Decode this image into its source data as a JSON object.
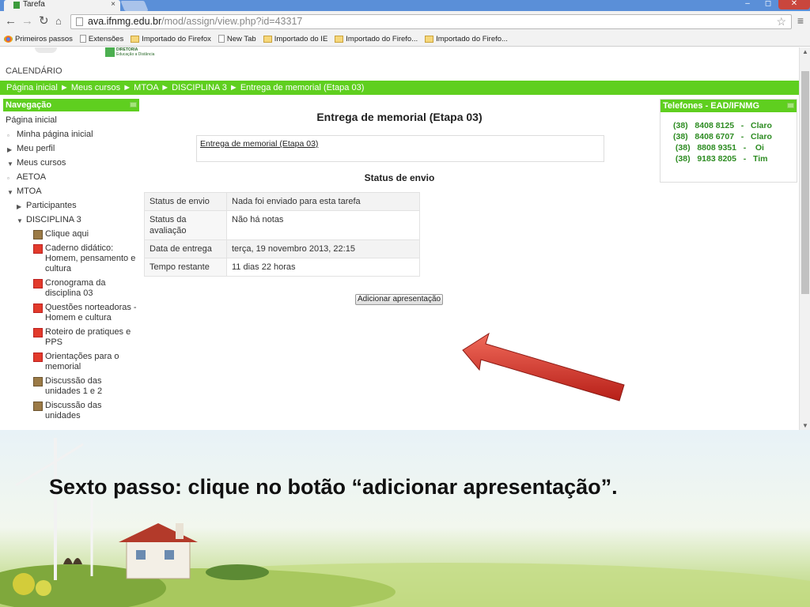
{
  "browser": {
    "tab_title": "Tarefa",
    "tab_close": "×",
    "url_host": "ava.ifnmg.edu.br",
    "url_path": "/mod/assign/view.php?id=43317",
    "bookmarks": [
      {
        "label": "Primeiros passos",
        "icon": "chrome"
      },
      {
        "label": "Extensões",
        "icon": "page"
      },
      {
        "label": "Importado do Firefox",
        "icon": "folder"
      },
      {
        "label": "New Tab",
        "icon": "page"
      },
      {
        "label": "Importado do IE",
        "icon": "folder"
      },
      {
        "label": "Importado do Firefo...",
        "icon": "folder"
      },
      {
        "label": "Importado do Firefo...",
        "icon": "folder"
      }
    ]
  },
  "site": {
    "logo_line1": "DIRETORIA",
    "logo_line2": "Educação a Distância",
    "calendar": "CALENDÁRIO",
    "breadcrumb": "Página inicial ► Meus cursos ► MTOA ► DISCIPLINA 3 ► Entrega de memorial (Etapa 03)"
  },
  "nav": {
    "title": "Navegação",
    "items": [
      {
        "label": "Página inicial",
        "indent": 0,
        "marker": "none"
      },
      {
        "label": "Minha página inicial",
        "indent": 1,
        "marker": "bullet"
      },
      {
        "label": "Meu perfil",
        "indent": 1,
        "marker": "collapsed"
      },
      {
        "label": "Meus cursos",
        "indent": 1,
        "marker": "expanded"
      },
      {
        "label": "AETOA",
        "indent": 2,
        "marker": "bullet"
      },
      {
        "label": "MTOA",
        "indent": 2,
        "marker": "expanded"
      },
      {
        "label": "Participantes",
        "indent": 3,
        "marker": "collapsed"
      },
      {
        "label": "DISCIPLINA 3",
        "indent": 3,
        "marker": "expanded"
      },
      {
        "label": "Clique aqui",
        "indent": 4,
        "marker": "forum"
      },
      {
        "label": "Caderno didático: Homem, pensamento e cultura",
        "indent": 4,
        "marker": "pdf"
      },
      {
        "label": "Cronograma da disciplina 03",
        "indent": 4,
        "marker": "pdf"
      },
      {
        "label": "Questões norteadoras - Homem e cultura",
        "indent": 4,
        "marker": "pdf"
      },
      {
        "label": "Roteiro de pratiques e PPS",
        "indent": 4,
        "marker": "pdf"
      },
      {
        "label": "Orientações para o memorial",
        "indent": 4,
        "marker": "pdf"
      },
      {
        "label": "Discussão das unidades 1 e 2",
        "indent": 4,
        "marker": "forum"
      },
      {
        "label": "Discussão das unidades",
        "indent": 4,
        "marker": "forum"
      }
    ]
  },
  "assignment": {
    "title": "Entrega de memorial (Etapa 03)",
    "intro_link": "Entrega de memorial (Etapa 03)",
    "status_heading": "Status de envio",
    "rows": [
      {
        "key": "Status de envio",
        "value": "Nada foi enviado para esta tarefa"
      },
      {
        "key": "Status da avaliação",
        "value": "Não há notas"
      },
      {
        "key": "Data de entrega",
        "value": "terça, 19 novembro 2013, 22:15"
      },
      {
        "key": "Tempo restante",
        "value": "11 dias 22 horas"
      }
    ],
    "add_button": "Adicionar apresentação"
  },
  "phones": {
    "title": "Telefones - EAD/IFNMG",
    "lines": [
      "(38)   8408 8125   -   Claro",
      "(38)   8408 6707   -   Claro",
      " (38)   8808 9351   -    Oi",
      " (38)   9183 8205   -   Tim"
    ]
  },
  "slide": {
    "caption": "Sexto passo: clique no botão “adicionar apresentação”."
  },
  "colors": {
    "moodle_green": "#5fcf1f",
    "phone_text": "#2d8c22",
    "arrow_red": "#d8322a"
  }
}
